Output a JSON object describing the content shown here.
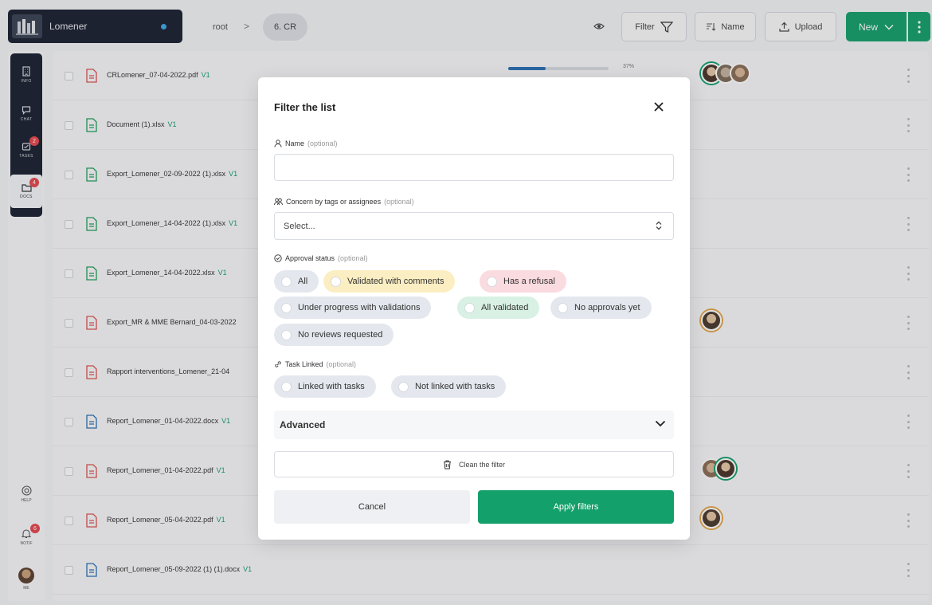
{
  "workspace": {
    "name": "Lomener"
  },
  "breadcrumb": {
    "root": "root",
    "separator": ">",
    "current": "6. CR"
  },
  "toolbar": {
    "filter_label": "Filter",
    "sort_label": "Name",
    "upload_label": "Upload",
    "new_label": "New"
  },
  "sidebar": {
    "items": [
      {
        "label": "INFO",
        "icon": "building-icon"
      },
      {
        "label": "CHAT",
        "icon": "chat-icon"
      },
      {
        "label": "TASKS",
        "icon": "tasks-icon",
        "badge": "2"
      },
      {
        "label": "DOCS",
        "icon": "docs-icon",
        "badge": "4"
      }
    ],
    "bottom": [
      {
        "label": "HELP",
        "icon": "help-icon"
      },
      {
        "label": "NOTIF",
        "icon": "bell-icon",
        "badge": "6"
      },
      {
        "label": "ME",
        "icon": "avatar"
      }
    ]
  },
  "files": [
    {
      "name": "CRLomener_07-04-2022.pdf",
      "version": "V1",
      "type": "pdf",
      "progress_pct": 37,
      "progress_label": "37%"
    },
    {
      "name": "Document (1).xlsx",
      "version": "V1",
      "type": "xlsx"
    },
    {
      "name": "Export_Lomener_02-09-2022 (1).xlsx",
      "version": "V1",
      "type": "xlsx"
    },
    {
      "name": "Export_Lomener_14-04-2022 (1).xlsx",
      "version": "V1",
      "type": "xlsx"
    },
    {
      "name": "Export_Lomener_14-04-2022.xlsx",
      "version": "V1",
      "type": "xlsx"
    },
    {
      "name": "Export_MR & MME Bernard_04-03-2022",
      "version": "",
      "type": "pdf"
    },
    {
      "name": "Rapport interventions_Lomener_21-04",
      "version": "",
      "type": "pdf"
    },
    {
      "name": "Report_Lomener_01-04-2022.docx",
      "version": "V1",
      "type": "docx"
    },
    {
      "name": "Report_Lomener_01-04-2022.pdf",
      "version": "V1",
      "type": "pdf"
    },
    {
      "name": "Report_Lomener_05-04-2022.pdf",
      "version": "V1",
      "type": "pdf"
    },
    {
      "name": "Report_Lomener_05-09-2022 (1) (1).docx",
      "version": "V1",
      "type": "docx"
    }
  ],
  "modal": {
    "title": "Filter the list",
    "name_label": "Name",
    "name_optional": "(optional)",
    "concern_label": "Concern by tags or assignees",
    "concern_optional": "(optional)",
    "concern_placeholder": "Select...",
    "approval_label": "Approval status",
    "approval_optional": "(optional)",
    "approval_options": [
      "All",
      "Validated with comments",
      "Has a refusal",
      "Under progress with validations",
      "All validated",
      "No approvals yet",
      "No reviews requested"
    ],
    "task_label": "Task Linked",
    "task_optional": "(optional)",
    "task_options": [
      "Linked with tasks",
      "Not linked with tasks"
    ],
    "advanced_label": "Advanced",
    "clean_label": "Clean the filter",
    "cancel_label": "Cancel",
    "apply_label": "Apply filters"
  },
  "colors": {
    "accent": "#14a06a",
    "dark": "#1b2130",
    "badge": "#e5484d",
    "progress": "#2b6fb3"
  }
}
